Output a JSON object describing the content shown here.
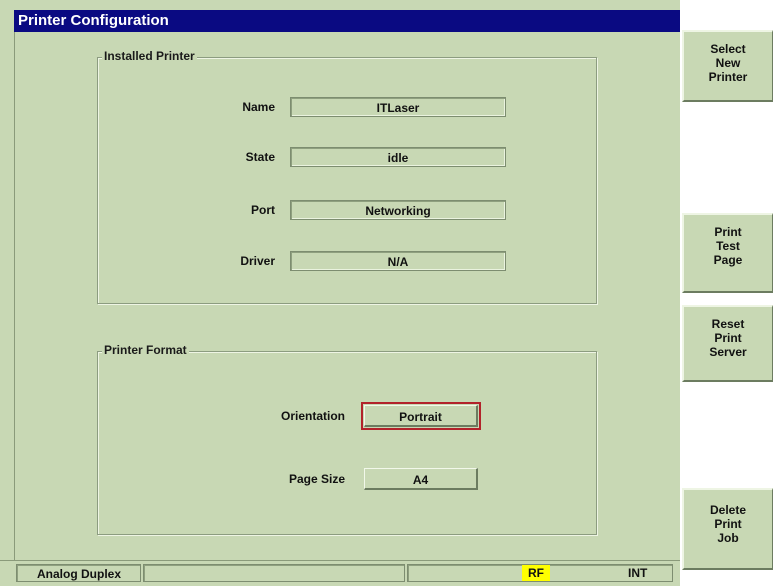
{
  "window": {
    "title": "Printer Configuration"
  },
  "installed": {
    "legend": "Installed Printer",
    "fields": [
      {
        "label": "Name",
        "value": "ITLaser"
      },
      {
        "label": "State",
        "value": "idle"
      },
      {
        "label": "Port",
        "value": "Networking"
      },
      {
        "label": "Driver",
        "value": "N/A"
      }
    ]
  },
  "format": {
    "legend": "Printer Format",
    "orientation_label": "Orientation",
    "orientation_value": "Portrait",
    "pagesize_label": "Page Size",
    "pagesize_value": "A4"
  },
  "softkeys": {
    "select_new_printer": [
      "Select",
      "New",
      "Printer"
    ],
    "print_test_page": [
      "Print",
      "Test",
      "Page"
    ],
    "reset_print_server": [
      "Reset",
      "Print",
      "Server"
    ],
    "delete_print_job": [
      "Delete",
      "Print",
      "Job"
    ]
  },
  "status": {
    "mode": "Analog Duplex",
    "rf": "RF",
    "int": "INT"
  },
  "colors": {
    "background": "#c8d8b4",
    "titlebar": "#0a0a82",
    "selected_outline": "#b2222a",
    "rf_highlight": "#ffff00"
  }
}
